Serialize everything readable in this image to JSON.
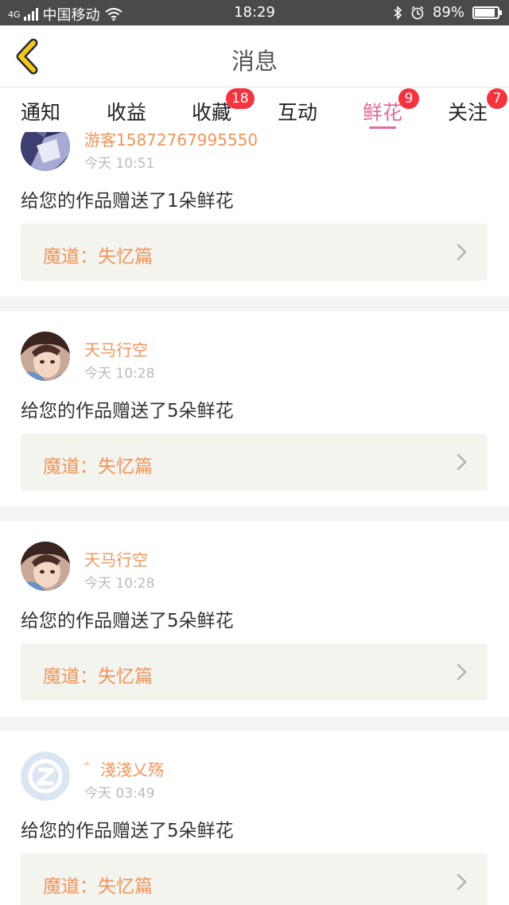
{
  "status_bar": {
    "network": "4G",
    "carrier": "中国移动",
    "time": "18:29",
    "battery_text": "89%",
    "battery_level": 0.89
  },
  "header": {
    "title": "消息",
    "back_icon": "chevron-left-icon"
  },
  "tabs": [
    {
      "label": "通知",
      "badge": ""
    },
    {
      "label": "收益",
      "badge": ""
    },
    {
      "label": "收藏",
      "badge": "18"
    },
    {
      "label": "互动",
      "badge": ""
    },
    {
      "label": "鲜花",
      "badge": "9",
      "active": true
    },
    {
      "label": "关注",
      "badge": "7"
    }
  ],
  "feed": {
    "items": [
      {
        "username": "游客15872767995550",
        "time": "今天 10:51",
        "message": "给您的作品赠送了1朵鲜花",
        "work_title": "魔道：失忆篇",
        "avatar": "crystal-avatar-icon"
      },
      {
        "username": "天马行空",
        "time": "今天 10:28",
        "message": "给您的作品赠送了5朵鲜花",
        "work_title": "魔道：失忆篇",
        "avatar": "anime-avatar-icon"
      },
      {
        "username": "天马行空",
        "time": "今天 10:28",
        "message": "给您的作品赠送了5朵鲜花",
        "work_title": "魔道：失忆篇",
        "avatar": "anime-avatar-icon"
      },
      {
        "username": "゛淺淺乂殇",
        "time": "今天 03:49",
        "message": "给您的作品赠送了5朵鲜花",
        "work_title": "魔道：失忆篇",
        "avatar": "default-avatar-icon"
      }
    ]
  },
  "colors": {
    "accent": "#e36b9b",
    "badge": "#f5333f",
    "username": "#f0955c",
    "back_arrow": "#f2c91e"
  }
}
